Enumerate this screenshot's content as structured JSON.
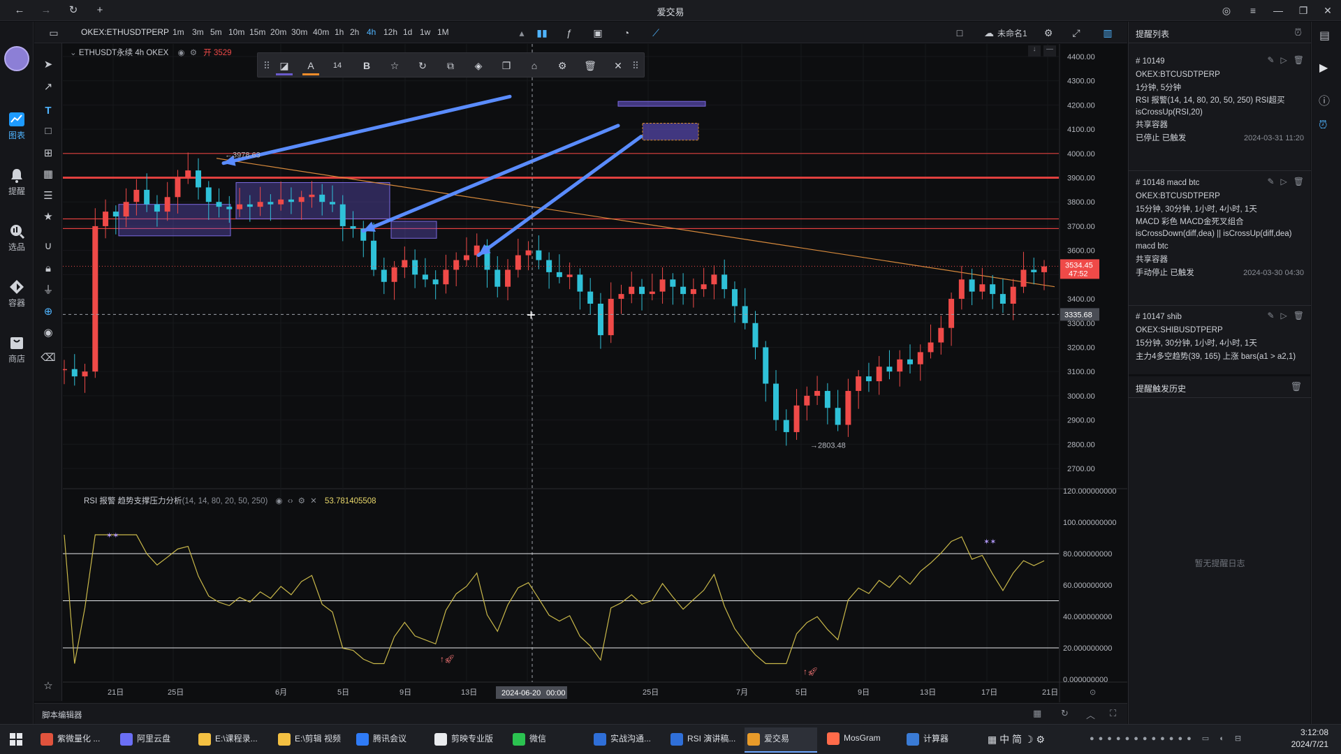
{
  "window": {
    "title": "爱交易"
  },
  "appbar": {
    "items": [
      {
        "label": "图表",
        "icon": "chart-icon"
      },
      {
        "label": "提醒",
        "icon": "bell-icon"
      },
      {
        "label": "选品",
        "icon": "search-coin-icon"
      },
      {
        "label": "容器",
        "icon": "container-icon"
      },
      {
        "label": "商店",
        "icon": "store-icon"
      }
    ]
  },
  "toolbar": {
    "symbol": "OKEX:ETHUSDTPERP",
    "timeframes": [
      "1m",
      "3m",
      "5m",
      "10m",
      "15m",
      "20m",
      "30m",
      "40m",
      "1h",
      "2h",
      "4h",
      "12h",
      "1d",
      "1w",
      "1M"
    ],
    "active_timeframe": "4h",
    "layout_name": "未命名1"
  },
  "legend": {
    "symbol_line": "ETHUSDT永续 4h OKEX",
    "open_label": "开 3529"
  },
  "drawbar": {
    "font_size": "14",
    "bold": "B",
    "text_tool": "A"
  },
  "price_axis": {
    "ticks": [
      "4400.00",
      "4300.00",
      "4200.00",
      "4100.00",
      "4000.00",
      "3900.00",
      "3800.00",
      "3700.00",
      "3600.00",
      "3500.00",
      "3400.00",
      "3300.00",
      "3200.00",
      "3100.00",
      "3000.00",
      "2900.00",
      "2800.00",
      "2700.00"
    ],
    "current_price": "3534.45",
    "countdown": "47:52",
    "crosshair_price": "3335.68",
    "high_label": "3978.63",
    "low_label": "2803.48"
  },
  "rsi_panel": {
    "title": "RSI 报警 趋势支撑压力分析",
    "params": "(14, 14, 80, 20, 50, 250)",
    "value": "53.781405508",
    "ticks": [
      "120.000000000",
      "100.000000000",
      "80.000000000",
      "60.000000000",
      "40.000000000",
      "20.000000000",
      "0.000000000"
    ]
  },
  "time_axis": {
    "ticks": [
      "21日",
      "25日",
      "6月",
      "5日",
      "9日",
      "13日",
      "17日",
      "25日",
      "7月",
      "5日",
      "9日",
      "13日",
      "17日",
      "21日"
    ],
    "crosshair_date": "2024-06-20",
    "crosshair_time": "00:00"
  },
  "chart_data": {
    "type": "candlestick",
    "symbol": "ETHUSDT",
    "interval": "4h",
    "ylim": [
      2700,
      4400
    ],
    "rsi_ylim": [
      0,
      120
    ],
    "rsi_levels": [
      80,
      50,
      20
    ],
    "horizontal_lines": [
      4000,
      3900,
      3730,
      3690
    ],
    "approx_closes": [
      3110,
      3080,
      3100,
      3700,
      3760,
      3740,
      3800,
      3850,
      3790,
      3760,
      3820,
      3900,
      3930,
      3860,
      3800,
      3780,
      3770,
      3790,
      3780,
      3800,
      3790,
      3810,
      3800,
      3820,
      3830,
      3800,
      3790,
      3700,
      3690,
      3640,
      3520,
      3470,
      3530,
      3560,
      3500,
      3480,
      3460,
      3520,
      3560,
      3580,
      3620,
      3520,
      3450,
      3520,
      3580,
      3600,
      3560,
      3510,
      3490,
      3500,
      3430,
      3380,
      3250,
      3400,
      3420,
      3450,
      3420,
      3430,
      3480,
      3450,
      3420,
      3440,
      3460,
      3500,
      3440,
      3370,
      3300,
      3200,
      3050,
      2900,
      2850,
      2960,
      3000,
      3020,
      2950,
      2880,
      3020,
      3080,
      3060,
      3120,
      3100,
      3150,
      3130,
      3180,
      3220,
      3280,
      3400,
      3480,
      3430,
      3460,
      3420,
      3380,
      3450,
      3520,
      3510,
      3534
    ]
  },
  "right_panel": {
    "title": "提醒列表",
    "alerts": [
      {
        "id": "# 10149",
        "symbol": "OKEX:BTCUSDTPERP",
        "intervals": "1分钟, 5分钟",
        "cond": "RSI 报警(14, 14, 80, 20, 50, 250) RSI超买 isCrossUp(RSI,20)",
        "share": "共享容器",
        "status": "已停止 已触发",
        "time": "2024-03-31 11:20"
      },
      {
        "id": "# 10148 macd btc",
        "symbol": "OKEX:BTCUSDTPERP",
        "intervals": "15分钟, 30分钟, 1小时, 4小时, 1天",
        "cond": "MACD 彩色 MACD金死叉组合 isCrossDown(diff,dea) || isCrossUp(diff,dea)",
        "name": "macd btc",
        "share": "共享容器",
        "status": "手动停止 已触发",
        "time": "2024-03-30 04:30"
      },
      {
        "id": "# 10147 shib",
        "symbol": "OKEX:SHIBUSDTPERP",
        "intervals": "15分钟, 30分钟, 1小时, 4小时, 1天",
        "cond": "主力4多空趋势(39, 165) 上涨 bars(a1 > a2,1)"
      }
    ],
    "history_title": "提醒触发历史",
    "history_empty": "暂无提醒日志"
  },
  "bottombar": {
    "label": "脚本编辑器"
  },
  "taskbar": {
    "apps": [
      {
        "label": "紫微量化 ...",
        "color": "#e0533d"
      },
      {
        "label": "阿里云盘",
        "color": "#6b6ff5"
      },
      {
        "label": "E:\\课程录...",
        "color": "#f3c042"
      },
      {
        "label": "E:\\剪辑 视频",
        "color": "#f3c042"
      },
      {
        "label": "腾讯会议",
        "color": "#2f7bf6"
      },
      {
        "label": "剪映专业版",
        "color": "#e9ebee"
      },
      {
        "label": "微信",
        "color": "#2bc250"
      },
      {
        "label": "实战沟通...",
        "color": "#2f6fd8"
      },
      {
        "label": "RSI 演讲稿...",
        "color": "#2f6fd8"
      },
      {
        "label": "爱交易",
        "color": "#e89b2a"
      },
      {
        "label": "MosGram",
        "color": "#ff6b4a"
      },
      {
        "label": "计算器",
        "color": "#3a7bd5"
      }
    ],
    "tray_text": "中 简",
    "time": "3:12:08",
    "date": "2024/7/21"
  }
}
